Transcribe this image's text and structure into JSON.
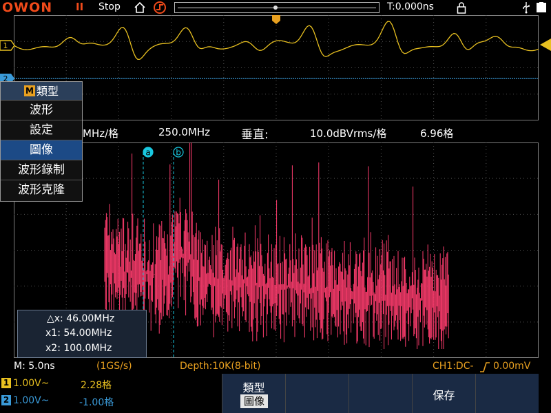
{
  "topbar": {
    "logo": "OWON",
    "run_state": "Stop",
    "time_offset": "T:0.000ns"
  },
  "fft": {
    "hscale_partial": "MHz/格",
    "center_freq": "250.0MHz",
    "vertical_label": "垂直:",
    "vertical_scale": "10.0dBVrms/格",
    "vertical_pos": "6.96格"
  },
  "menu": {
    "badge": "M",
    "title": "類型",
    "items": [
      {
        "label": "波形"
      },
      {
        "label": "設定"
      },
      {
        "label": "圖像",
        "selected": true
      },
      {
        "label": "波形錄制"
      },
      {
        "label": "波形克隆"
      }
    ]
  },
  "cursors": {
    "a_label": "a",
    "b_label": "b",
    "delta": "△x: 46.00MHz",
    "x1": "x1: 54.00MHz",
    "x2": "x2: 100.0MHz"
  },
  "status": {
    "timebase": "M: 5.0ns",
    "sample_rate": "(1GS/s)",
    "depth": "Depth:10K(8-bit)",
    "trigger": "CH1:DC-",
    "trigger_level": "0.00mV"
  },
  "channels": [
    {
      "id": "1",
      "scale": "1.00V~",
      "offset": "2.28格",
      "color": "#e8c020"
    },
    {
      "id": "2",
      "scale": "1.00V~",
      "offset": "-1.00格",
      "color": "#3a9ad8"
    }
  ],
  "softkeys": {
    "type_label": "類型",
    "type_value": "圖像",
    "save_label": "保存"
  },
  "colors": {
    "ch1": "#e8c020",
    "ch2": "#3a9ad8",
    "fft": "#ff3c6e",
    "brand": "#f04a1a",
    "cursor": "#19c8e0"
  }
}
